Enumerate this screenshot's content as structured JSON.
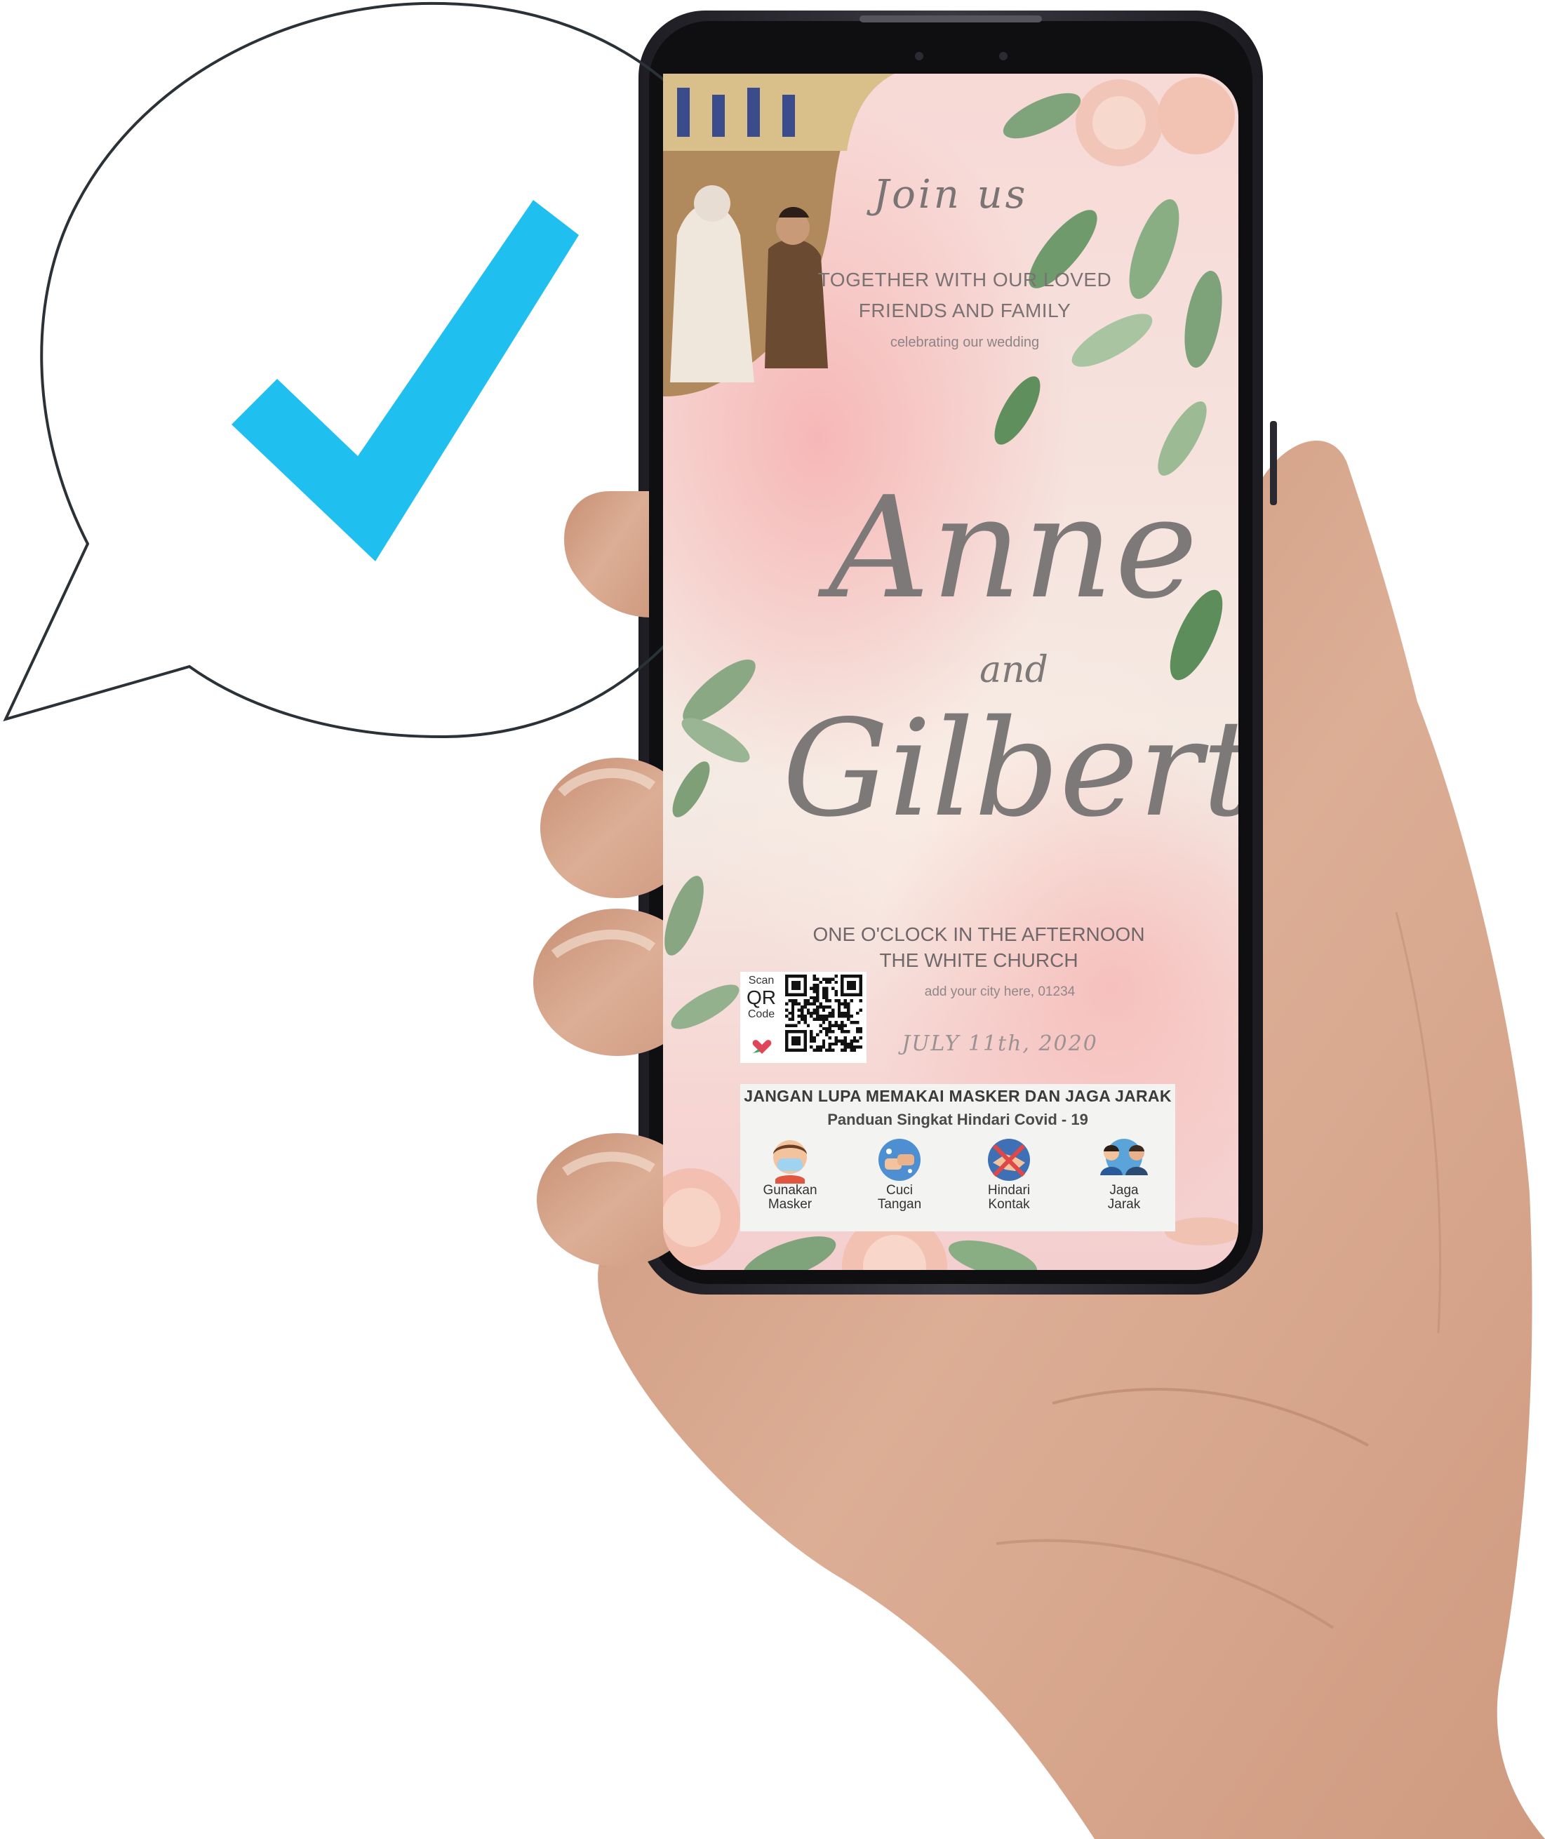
{
  "invitation": {
    "join_text": "Join us",
    "together_line1": "TOGETHER WITH OUR LOVED",
    "together_line2": "FRIENDS AND FAMILY",
    "celebrating": "celebrating our wedding",
    "bride": "Anne",
    "and": "and",
    "groom": "Gilbert",
    "time": "ONE O'CLOCK IN THE AFTERNOON",
    "venue": "THE WHITE CHURCH",
    "city": "add your city here, 01234",
    "date": "JULY 11th, 2020"
  },
  "qr": {
    "label_top": "Scan",
    "label_mid": "QR",
    "label_bottom": "Code"
  },
  "covid": {
    "title": "JANGAN LUPA MEMAKAI MASKER DAN JAGA JARAK",
    "subtitle": "Panduan Singkat Hindari Covid - 19",
    "tips": [
      {
        "line1": "Gunakan",
        "line2": "Masker",
        "icon": "face-mask-icon"
      },
      {
        "line1": "Cuci",
        "line2": "Tangan",
        "icon": "hand-wash-icon"
      },
      {
        "line1": "Hindari",
        "line2": "Kontak",
        "icon": "handshake-icon"
      },
      {
        "line1": "Jaga",
        "line2": "Jarak",
        "icon": "social-distance-icon"
      }
    ]
  },
  "colors": {
    "checkmark": "#1fc0f0",
    "bubble_stroke": "#2a3238",
    "phone_frame": "#2b2a31",
    "skin": "#d8a98e"
  }
}
